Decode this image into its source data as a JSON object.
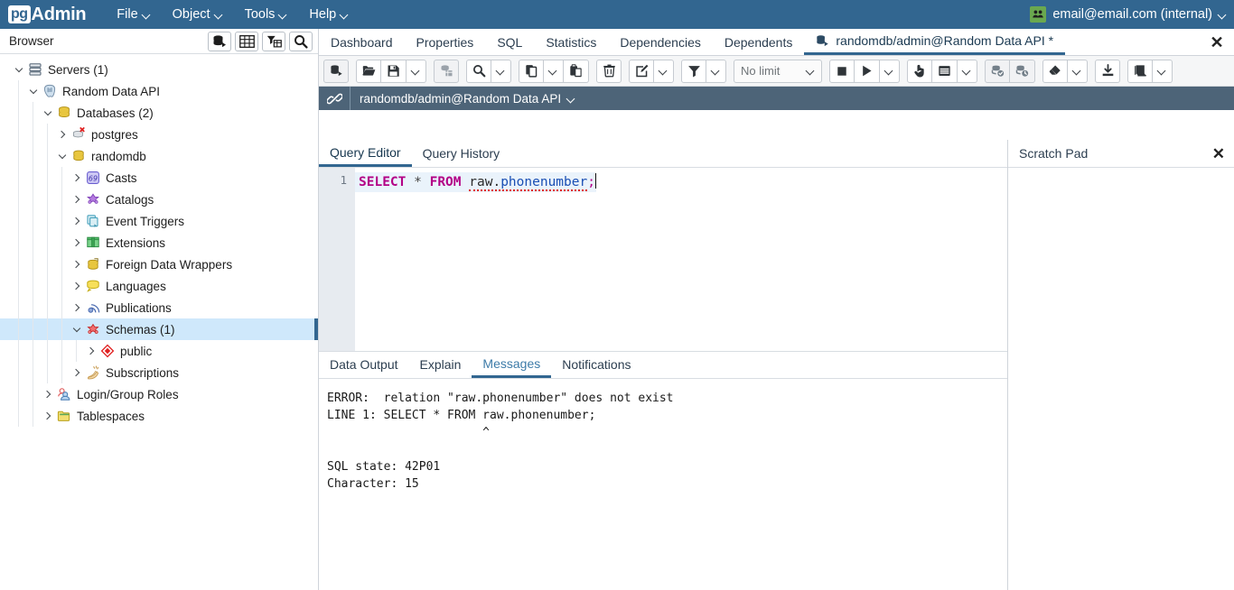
{
  "menubar": {
    "brand_pg": "pg",
    "brand_admin": "Admin",
    "items": [
      {
        "label": "File",
        "icon": "chevron-down-icon"
      },
      {
        "label": "Object",
        "icon": "chevron-down-icon"
      },
      {
        "label": "Tools",
        "icon": "chevron-down-icon"
      },
      {
        "label": "Help",
        "icon": "chevron-down-icon"
      }
    ],
    "user": {
      "label": "email@email.com (internal)",
      "icon": "users-icon",
      "caret": "chevron-down-icon"
    },
    "background": "#326690"
  },
  "browser": {
    "title": "Browser",
    "buttons": [
      {
        "name": "add-server-icon",
        "title": ""
      },
      {
        "name": "grid-view-icon",
        "title": ""
      },
      {
        "name": "filter-table-icon",
        "title": ""
      },
      {
        "name": "search-icon",
        "title": ""
      }
    ],
    "tree": [
      {
        "label": "Servers (1)",
        "depth": 0,
        "state": "open",
        "icon": "servers-icon",
        "selected": false
      },
      {
        "label": "Random Data API",
        "depth": 1,
        "state": "open",
        "icon": "postgres-server-icon",
        "selected": false
      },
      {
        "label": "Databases (2)",
        "depth": 2,
        "state": "open",
        "icon": "databases-icon",
        "selected": false
      },
      {
        "label": "postgres",
        "depth": 3,
        "state": "closed",
        "icon": "database-disconnected-icon",
        "selected": false
      },
      {
        "label": "randomdb",
        "depth": 3,
        "state": "open",
        "icon": "database-icon",
        "selected": false
      },
      {
        "label": "Casts",
        "depth": 4,
        "state": "closed",
        "icon": "casts-icon",
        "selected": false
      },
      {
        "label": "Catalogs",
        "depth": 4,
        "state": "closed",
        "icon": "catalogs-icon",
        "selected": false
      },
      {
        "label": "Event Triggers",
        "depth": 4,
        "state": "closed",
        "icon": "event-triggers-icon",
        "selected": false
      },
      {
        "label": "Extensions",
        "depth": 4,
        "state": "closed",
        "icon": "extensions-icon",
        "selected": false
      },
      {
        "label": "Foreign Data Wrappers",
        "depth": 4,
        "state": "closed",
        "icon": "foreign-data-wrappers-icon",
        "selected": false
      },
      {
        "label": "Languages",
        "depth": 4,
        "state": "closed",
        "icon": "languages-icon",
        "selected": false
      },
      {
        "label": "Publications",
        "depth": 4,
        "state": "closed",
        "icon": "publications-icon",
        "selected": false
      },
      {
        "label": "Schemas (1)",
        "depth": 4,
        "state": "open",
        "icon": "schemas-icon",
        "selected": true
      },
      {
        "label": "public",
        "depth": 5,
        "state": "closed",
        "icon": "schema-icon",
        "selected": false
      },
      {
        "label": "Subscriptions",
        "depth": 4,
        "state": "closed",
        "icon": "subscriptions-icon",
        "selected": false
      },
      {
        "label": "Login/Group Roles",
        "depth": 2,
        "state": "closed",
        "icon": "roles-icon",
        "selected": false
      },
      {
        "label": "Tablespaces",
        "depth": 2,
        "state": "closed",
        "icon": "tablespaces-icon",
        "selected": false
      }
    ]
  },
  "object_tabs": {
    "items": [
      {
        "label": "Dashboard",
        "active": false
      },
      {
        "label": "Properties",
        "active": false
      },
      {
        "label": "SQL",
        "active": false
      },
      {
        "label": "Statistics",
        "active": false
      },
      {
        "label": "Dependencies",
        "active": false
      },
      {
        "label": "Dependents",
        "active": false
      },
      {
        "label": "randomdb/admin@Random Data API *",
        "active": true,
        "icon": "query-tool-icon"
      }
    ],
    "close_label": "✕"
  },
  "query_toolbar": {
    "groups": [
      {
        "buttons": [
          {
            "name": "open-query-tool-button",
            "icon": "query-tool-icon",
            "disabled": true
          }
        ]
      },
      {
        "buttons": [
          {
            "name": "open-file-button",
            "icon": "folder-open-icon",
            "disabled": false
          },
          {
            "name": "save-file-button",
            "icon": "save-icon",
            "disabled": false
          },
          {
            "name": "save-dropdown-button",
            "icon": "chevron-down-icon",
            "disabled": false
          }
        ]
      },
      {
        "buttons": [
          {
            "name": "edit-data-button",
            "icon": "data-grid-icon",
            "disabled": true
          }
        ]
      },
      {
        "buttons": [
          {
            "name": "find-button",
            "icon": "search-icon",
            "disabled": false
          },
          {
            "name": "find-dropdown-button",
            "icon": "chevron-down-icon",
            "disabled": false
          }
        ]
      },
      {
        "buttons": [
          {
            "name": "copy-button",
            "icon": "copy-icon",
            "disabled": false
          },
          {
            "name": "copy-dropdown-button",
            "icon": "chevron-down-icon",
            "disabled": false
          },
          {
            "name": "paste-button",
            "icon": "paste-icon",
            "disabled": false
          }
        ]
      },
      {
        "buttons": [
          {
            "name": "delete-row-button",
            "icon": "trash-icon",
            "disabled": false
          }
        ]
      },
      {
        "buttons": [
          {
            "name": "edit-options-button",
            "icon": "edit-pencil-icon",
            "disabled": false
          },
          {
            "name": "edit-options-dropdown-button",
            "icon": "chevron-down-icon",
            "disabled": false
          }
        ]
      },
      {
        "buttons": [
          {
            "name": "filter-button",
            "icon": "filter-icon",
            "disabled": false
          },
          {
            "name": "filter-dropdown-button",
            "icon": "chevron-down-icon",
            "disabled": false
          }
        ]
      },
      {
        "buttons": [
          {
            "name": "stop-query-button",
            "icon": "stop-icon",
            "disabled": false
          },
          {
            "name": "execute-query-button",
            "icon": "play-icon",
            "disabled": false
          },
          {
            "name": "execute-dropdown-button",
            "icon": "chevron-down-icon",
            "disabled": false
          }
        ]
      },
      {
        "buttons": [
          {
            "name": "explain-button",
            "icon": "hand-pointer-icon",
            "disabled": false
          },
          {
            "name": "explain-analyze-button",
            "icon": "explain-panel-icon",
            "disabled": false
          },
          {
            "name": "explain-dropdown-button",
            "icon": "chevron-down-icon",
            "disabled": false
          }
        ]
      },
      {
        "buttons": [
          {
            "name": "commit-button",
            "icon": "commit-icon",
            "disabled": true
          },
          {
            "name": "rollback-button",
            "icon": "rollback-icon",
            "disabled": true
          }
        ]
      },
      {
        "buttons": [
          {
            "name": "clear-button",
            "icon": "eraser-icon",
            "disabled": false
          },
          {
            "name": "clear-dropdown-button",
            "icon": "chevron-down-icon",
            "disabled": false
          }
        ]
      },
      {
        "buttons": [
          {
            "name": "download-csv-button",
            "icon": "download-icon",
            "disabled": false
          }
        ]
      },
      {
        "buttons": [
          {
            "name": "macros-button",
            "icon": "macros-icon",
            "disabled": false
          },
          {
            "name": "macros-dropdown-button",
            "icon": "chevron-down-icon",
            "disabled": false
          }
        ]
      }
    ],
    "limit": {
      "value": "No limit",
      "icon": "chevron-down-icon"
    }
  },
  "connection_bar": {
    "icon": "connection-icon",
    "label": "randomdb/admin@Random Data API",
    "caret": "chevron-down-icon",
    "background": "#4d6478"
  },
  "editor_tabs": {
    "items": [
      {
        "label": "Query Editor",
        "active": true
      },
      {
        "label": "Query History",
        "active": false
      }
    ]
  },
  "scratch_pad": {
    "title": "Scratch Pad",
    "close_label": "✕",
    "content": ""
  },
  "sql_editor": {
    "line_number": "1",
    "tokens": [
      {
        "text": "SELECT",
        "kind": "keyword"
      },
      {
        "text": " ",
        "kind": "plain"
      },
      {
        "text": "*",
        "kind": "star"
      },
      {
        "text": " ",
        "kind": "plain"
      },
      {
        "text": "FROM",
        "kind": "keyword"
      },
      {
        "text": " ",
        "kind": "plain"
      },
      {
        "text": "raw",
        "kind": "ident-error"
      },
      {
        "text": ".",
        "kind": "ident-error"
      },
      {
        "text": "phonenumber",
        "kind": "column-error"
      },
      {
        "text": ";",
        "kind": "semicolon"
      }
    ],
    "full_text": "SELECT * FROM raw.phonenumber;"
  },
  "output_tabs": {
    "items": [
      {
        "label": "Data Output",
        "active": false
      },
      {
        "label": "Explain",
        "active": false
      },
      {
        "label": "Messages",
        "active": true
      },
      {
        "label": "Notifications",
        "active": false
      }
    ]
  },
  "messages": {
    "text": "ERROR:  relation \"raw.phonenumber\" does not exist\nLINE 1: SELECT * FROM raw.phonenumber;\n                      ^\n\nSQL state: 42P01\nCharacter: 15"
  },
  "colors": {
    "brand_blue": "#326690",
    "conn_bar": "#4d6478",
    "selection": "#cfe8fb",
    "keyword": "#b30086",
    "column": "#1a4fb4",
    "error_underline": "#e02020"
  }
}
